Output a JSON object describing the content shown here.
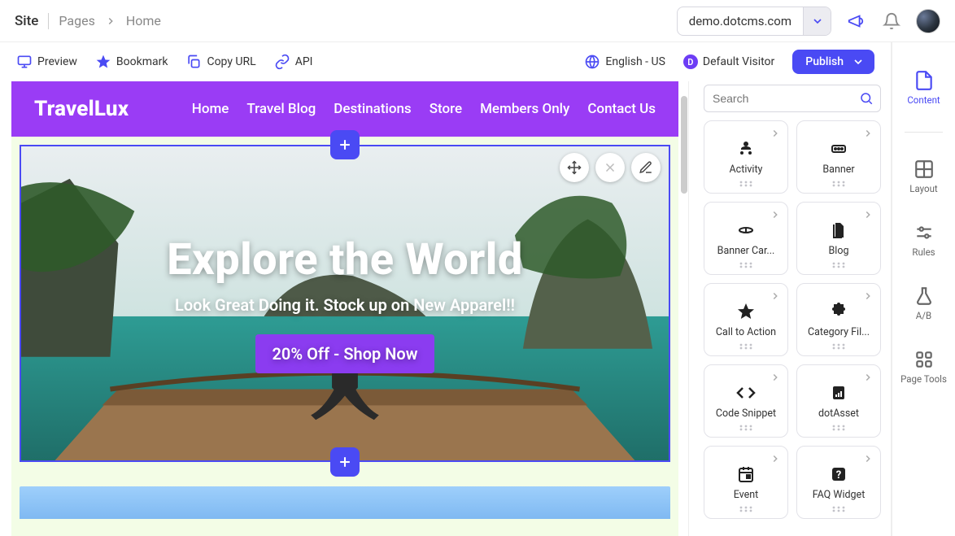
{
  "breadcrumb": {
    "site_label": "Site",
    "section": "Pages",
    "current": "Home"
  },
  "site_selector": {
    "value": "demo.dotcms.com"
  },
  "toolbar": {
    "preview": "Preview",
    "bookmark": "Bookmark",
    "copy_url": "Copy URL",
    "api": "API",
    "locale": "English - US",
    "visitor_label": "Default Visitor",
    "visitor_initial": "D",
    "publish": "Publish"
  },
  "page": {
    "brand": "TravelLux",
    "nav": [
      "Home",
      "Travel Blog",
      "Destinations",
      "Store",
      "Members Only",
      "Contact Us"
    ],
    "hero": {
      "title": "Explore the World",
      "subtitle": "Look Great Doing it. Stock up on New Apparel!!",
      "cta": "20% Off - Shop Now"
    }
  },
  "palette": {
    "search_placeholder": "Search",
    "items": [
      {
        "label": "Activity",
        "icon": "activity"
      },
      {
        "label": "Banner",
        "icon": "banner"
      },
      {
        "label": "Banner Car...",
        "icon": "carousel"
      },
      {
        "label": "Blog",
        "icon": "blog"
      },
      {
        "label": "Call to Action",
        "icon": "star"
      },
      {
        "label": "Category Fil...",
        "icon": "puzzle"
      },
      {
        "label": "Code Snippet",
        "icon": "code"
      },
      {
        "label": "dotAsset",
        "icon": "asset"
      },
      {
        "label": "Event",
        "icon": "event"
      },
      {
        "label": "FAQ Widget",
        "icon": "faq"
      }
    ]
  },
  "rail": {
    "content": "Content",
    "layout": "Layout",
    "rules": "Rules",
    "ab": "A/B",
    "page_tools": "Page Tools"
  },
  "colors": {
    "accent": "#4a4af4",
    "brand_purple": "#9a3cf5"
  }
}
